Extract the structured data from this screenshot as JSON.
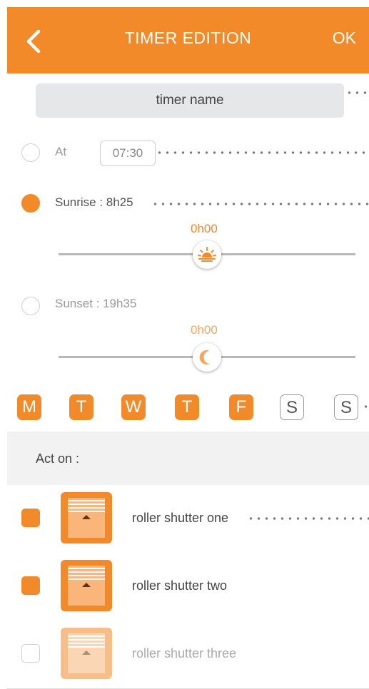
{
  "header": {
    "title": "TIMER EDITION",
    "ok_label": "OK",
    "back_icon": "chevron-left-icon"
  },
  "timer_name": {
    "placeholder": "timer name",
    "value": ""
  },
  "options": {
    "at": {
      "label": "At",
      "time": "07:30",
      "selected": false
    },
    "sunrise": {
      "label": "Sunrise : 8h25",
      "offset": "0h00",
      "selected": true,
      "icon": "sunrise-icon"
    },
    "sunset": {
      "label": "Sunset : 19h35",
      "offset": "0h00",
      "selected": false,
      "icon": "moon-icon"
    }
  },
  "days": [
    {
      "label": "M",
      "active": true
    },
    {
      "label": "T",
      "active": true
    },
    {
      "label": "W",
      "active": true
    },
    {
      "label": "T",
      "active": true
    },
    {
      "label": "F",
      "active": true
    },
    {
      "label": "S",
      "active": false
    },
    {
      "label": "S",
      "active": false
    }
  ],
  "act_on": {
    "label": "Act on :"
  },
  "devices": [
    {
      "name": "roller shutter one",
      "checked": true,
      "icon": "roller-shutter-icon"
    },
    {
      "name": "roller shutter two",
      "checked": true,
      "icon": "roller-shutter-icon"
    },
    {
      "name": "roller shutter three",
      "checked": false,
      "icon": "roller-shutter-icon"
    }
  ],
  "colors": {
    "accent": "#f28a2a",
    "accent_light": "#f7a660",
    "divider": "#e2e2e2",
    "header_bg": "#f2f2f2"
  }
}
